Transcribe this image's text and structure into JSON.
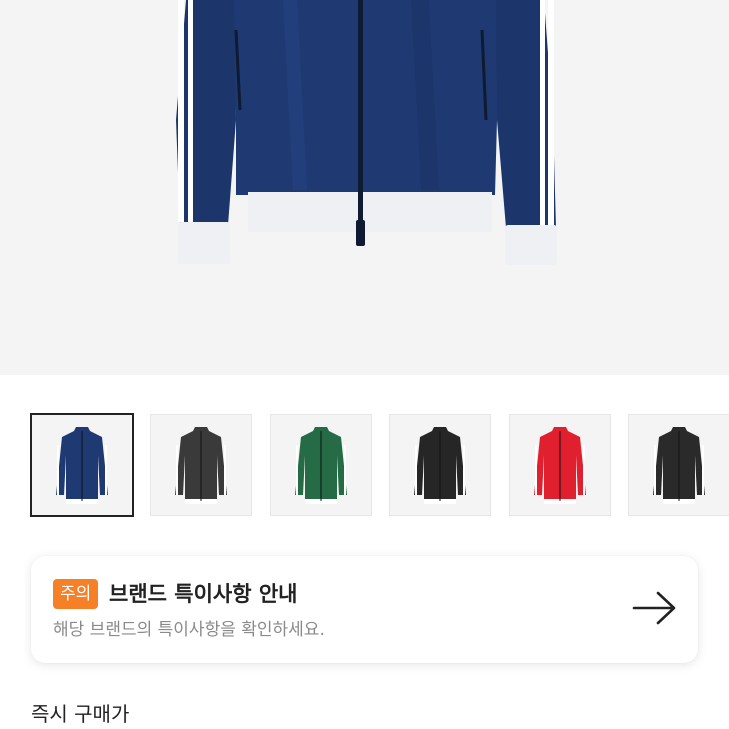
{
  "product": {
    "image_name": "navy-track-jacket",
    "thumbnails": [
      {
        "name": "navy",
        "color": "#1f3a73",
        "trim": "#ffffff",
        "selected": true
      },
      {
        "name": "charcoal",
        "color": "#3a3a3a",
        "trim": "#ffffff",
        "selected": false
      },
      {
        "name": "green",
        "color": "#256b45",
        "trim": "#ffffff",
        "selected": false
      },
      {
        "name": "black",
        "color": "#262626",
        "trim": "#ffffff",
        "selected": false
      },
      {
        "name": "red",
        "color": "#e0202e",
        "trim": "#ffffff",
        "selected": false
      },
      {
        "name": "black-2",
        "color": "#2a2a2a",
        "trim": "#ffffff",
        "selected": false
      }
    ]
  },
  "notice": {
    "badge": "주의",
    "title": "브랜드 특이사항 안내",
    "subtitle": "해당 브랜드의 특이사항을 확인하세요.",
    "badge_color": "#f58025",
    "arrow_icon": "arrow-right-icon"
  },
  "section": {
    "title": "즉시 구매가"
  }
}
